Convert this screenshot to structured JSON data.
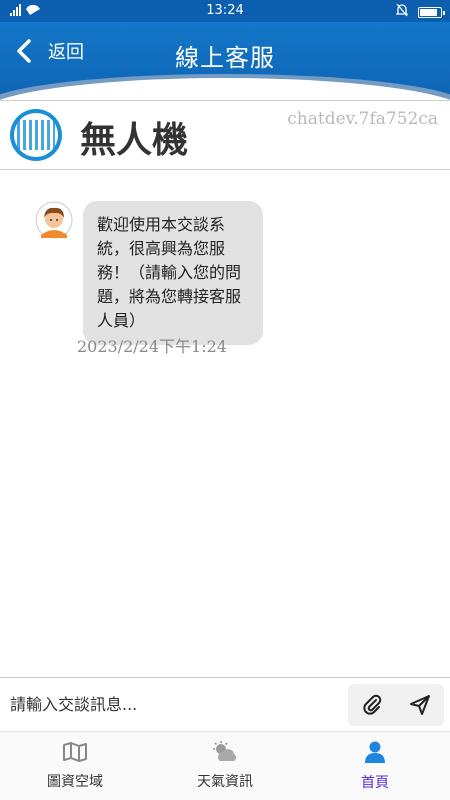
{
  "status_bar": {
    "time": "13:24"
  },
  "header": {
    "back_label": "返回",
    "title": "線上客服"
  },
  "org": {
    "name": "無人機",
    "code": "chatdev.7fa752ca"
  },
  "chat": {
    "messages": [
      {
        "text": "歡迎使用本交談系統，很高興為您服務！（請輸入您的問題，將為您轉接客服人員）",
        "time": "2023/2/24下午1:24"
      }
    ]
  },
  "input": {
    "placeholder": "請輸入交談訊息..."
  },
  "tabs": [
    {
      "label": "圖資空域",
      "icon": "map-icon",
      "active": false
    },
    {
      "label": "天氣資訊",
      "icon": "weather-icon",
      "active": false
    },
    {
      "label": "首頁",
      "icon": "person-icon",
      "active": true
    }
  ],
  "colors": {
    "header": "#0e64b4",
    "active_tab": "#5b2bd6",
    "bubble": "#e2e2e2"
  }
}
